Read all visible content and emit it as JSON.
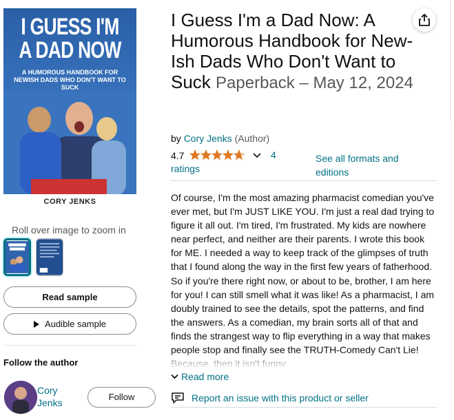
{
  "cover": {
    "title": "I GUESS I'M A DAD NOW",
    "subtitle": "A HUMOROUS HANDBOOK FOR NEWISH DADS WHO DON'T WANT TO SUCK",
    "author": "CORY JENKS"
  },
  "gallery": {
    "zoom_hint": "Roll over image to zoom in"
  },
  "buttons": {
    "read_sample": "Read sample",
    "audible_sample": "Audible sample",
    "follow": "Follow"
  },
  "follow_author": {
    "heading": "Follow the author",
    "name_line1": "Cory",
    "name_line2": "Jenks"
  },
  "product": {
    "title": "I Guess I'm a Dad Now: A Humorous Handbook for New-Ish Dads Who Don't Want to Suck",
    "format": "Paperback – May 12, 2024",
    "by_prefix": "by",
    "author": "Cory Jenks",
    "author_role": "(Author)",
    "rating_value": "4.7",
    "rating_stars": 4.7,
    "rating_count": "4",
    "ratings_word": "ratings",
    "see_all_formats": "See all formats and editions",
    "description": "Of course, I'm the most amazing pharmacist comedian you've ever met, but I'm JUST LIKE YOU. I'm just a real dad trying to figure it all out. I'm tired, I'm frustrated. My kids are nowhere near perfect, and neither are their parents. I wrote this book for ME. I needed a way to keep track of the glimpses of truth that I found along the way in the first few years of fatherhood. So if you're there right now, or about to be, brother, I am here for you! I can still smell what it was like! As a pharmacist, I am doubly trained to see the details, spot the patterns, and find the answers. As a comedian, my brain sorts all of that and finds the strangest way to flip everything in a way that makes people stop and finally see the TRUTH-Comedy Can't Lie! Because, then it isn't funny.",
    "read_more": "Read more",
    "report_issue": "Report an issue with this product or seller"
  },
  "colors": {
    "link": "#007185",
    "star": "#de7921",
    "cover_blue": "#2f64ad"
  }
}
